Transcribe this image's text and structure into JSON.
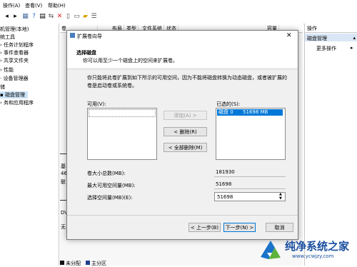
{
  "menubar": {
    "items": [
      "操作(A)",
      "查看(V)",
      "帮助(H)"
    ]
  },
  "tree": {
    "items": [
      "机管理(本地)",
      "统工具",
      "任务计划程序",
      "事件查看器",
      "共享文件夹",
      "性能",
      "设备管理器",
      "储",
      "磁盘管理",
      "务和应用程序"
    ]
  },
  "columns": {
    "headers": [
      "卷",
      "布局",
      "类型",
      "文件系统",
      "状态",
      "容量"
    ]
  },
  "actions": {
    "header": "操作",
    "selected": "磁盘管理",
    "more": "更多操作"
  },
  "disk_fragments": {
    "lines": [
      "基",
      "46",
      "联",
      "DV",
      "无"
    ]
  },
  "legend": {
    "items": [
      "未分配",
      "主分区"
    ]
  },
  "dialog": {
    "title": "扩展卷向导",
    "heading": "选择磁盘",
    "subheading": "你可以用至少一个磁盘上的空间来扩展卷。",
    "description": "你只能将此卷扩展到如下所示的可用空间，因为不能将磁盘转换为动态磁盘，或者被扩展的卷是启动卷或系统卷。",
    "available_label": "可用(V):",
    "selected_label": "已选的(S):",
    "add_button": "添加(A) >",
    "remove_button": "< 删除(R)",
    "remove_all_button": "< 全部删除(M)",
    "selected_items": [
      {
        "disk": "磁盘 0",
        "size": "51698 MB"
      }
    ],
    "total_label": "卷大小总数(MB):",
    "total_value": "181930",
    "max_label": "最大可用空间量(MB):",
    "max_value": "51698",
    "select_label": "选择空间量(MB)(E):",
    "select_value": "51698",
    "back_button": "< 上一步(B)",
    "next_button": "下一步(N) >",
    "cancel_button": "取消"
  },
  "watermark": {
    "title": "纯净系统之家",
    "url": "www.ycwjzy.com"
  },
  "colors": {
    "selection": "#0078d7",
    "accent_blue": "#1a73c8",
    "accent_green": "#5db33b"
  }
}
